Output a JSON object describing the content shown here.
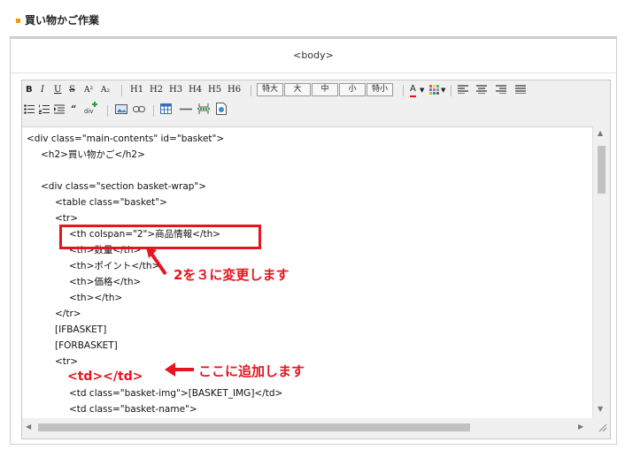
{
  "section": {
    "title": "買い物かご作業"
  },
  "panel": {
    "header": "<body>"
  },
  "toolbar": {
    "format": [
      "B",
      "I",
      "U",
      "S",
      "A²",
      "A₂"
    ],
    "headings": [
      "H1",
      "H2",
      "H3",
      "H4",
      "H5",
      "H6"
    ],
    "font_sizes": [
      "特大",
      "大",
      "中",
      "小",
      "特小"
    ],
    "font_color_label": "A"
  },
  "code_lines": [
    "<div class=\"main-contents\" id=\"basket\">",
    "<h2>買い物かご</h2>",
    "",
    "<div class=\"section basket-wrap\">",
    "<table class=\"basket\">",
    "<tr>",
    "<th colspan=\"2\">商品情報</th>",
    "<th>数量</th>",
    "<th>ポイント</th>",
    "<th>価格</th>",
    "<th></th>",
    "</tr>",
    "[IFBASKET]",
    "[FORBASKET]",
    "<tr>",
    "<td></td>",
    "<td class=\"basket-img\">[BASKET_IMG]</td>",
    "<td class=\"basket-name\">"
  ],
  "annotations": {
    "change": "2を３に変更します",
    "add": "ここに追加します"
  },
  "colors": {
    "annotation": "#e8141e",
    "accent": "#f39800"
  }
}
